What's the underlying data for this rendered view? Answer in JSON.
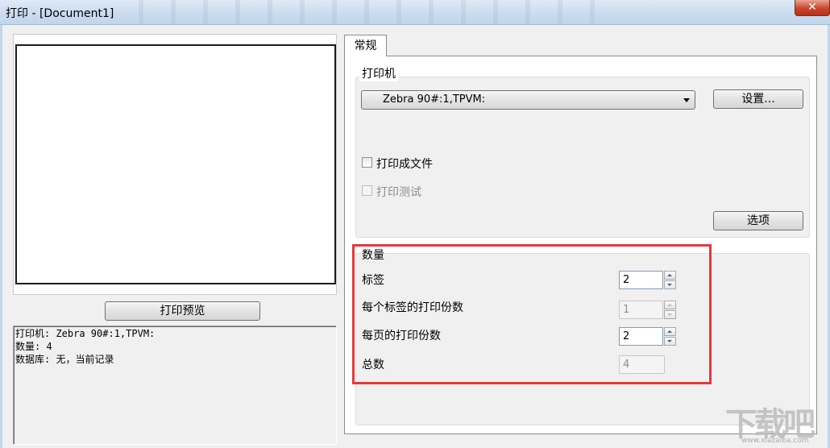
{
  "window": {
    "title": "打印 - [Document1]",
    "close_symbol": "✕"
  },
  "left": {
    "preview_button": "打印预览",
    "status_lines": [
      "打印机: Zebra 90#:1,TPVM:",
      "数量: 4",
      "数据库: 无，当前记录"
    ]
  },
  "tabs": [
    {
      "label": "常规",
      "active": true
    }
  ],
  "printer_group": {
    "label": "打印机",
    "selected_printer": "Zebra 90#:1,TPVM:",
    "settings_button": "设置...",
    "print_to_file_label": "打印成文件",
    "print_to_file_checked": false,
    "print_test_label": "打印测试",
    "print_test_checked": false,
    "print_test_enabled": false,
    "options_button": "选项"
  },
  "quantity_group": {
    "label": "数量",
    "labels_label": "标签",
    "labels_value": "2",
    "copies_per_label_label": "每个标签的打印份数",
    "copies_per_label_value": "1",
    "copies_per_page_label": "每页的打印份数",
    "copies_per_page_value": "2",
    "total_label": "总数",
    "total_value": "4"
  },
  "watermark": {
    "text": "下载吧",
    "sub": "www.xiazaiba.com"
  },
  "colors": {
    "highlight": "#e4393c",
    "titlebar": "#c9dbee"
  }
}
